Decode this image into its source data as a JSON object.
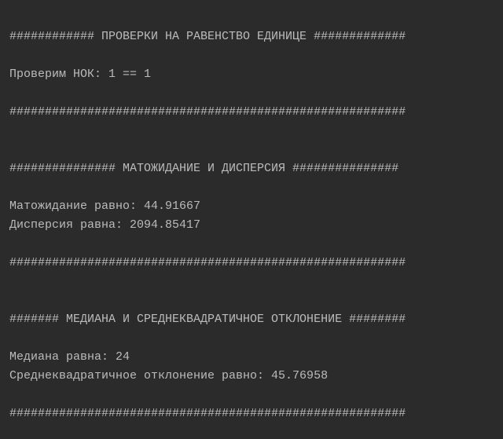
{
  "output": {
    "lines": [
      "############ ПРОВЕРКИ НА РАВЕНСТВО ЕДИНИЦЕ #############",
      "Проверим НОК: 1 == 1",
      "########################################################",
      "############### МАТОЖИДАНИЕ И ДИСПЕРСИЯ ###############",
      "Матожидание равно: 44.91667",
      "Дисперсия равна: 2094.85417",
      "########################################################",
      "####### МЕДИАНА И СРЕДНЕКВАДРАТИЧНОЕ ОТКЛОНЕНИЕ ########",
      "Медиана равна: 24",
      "Среднеквадратичное отклонение равно: 45.76958",
      "########################################################"
    ]
  }
}
